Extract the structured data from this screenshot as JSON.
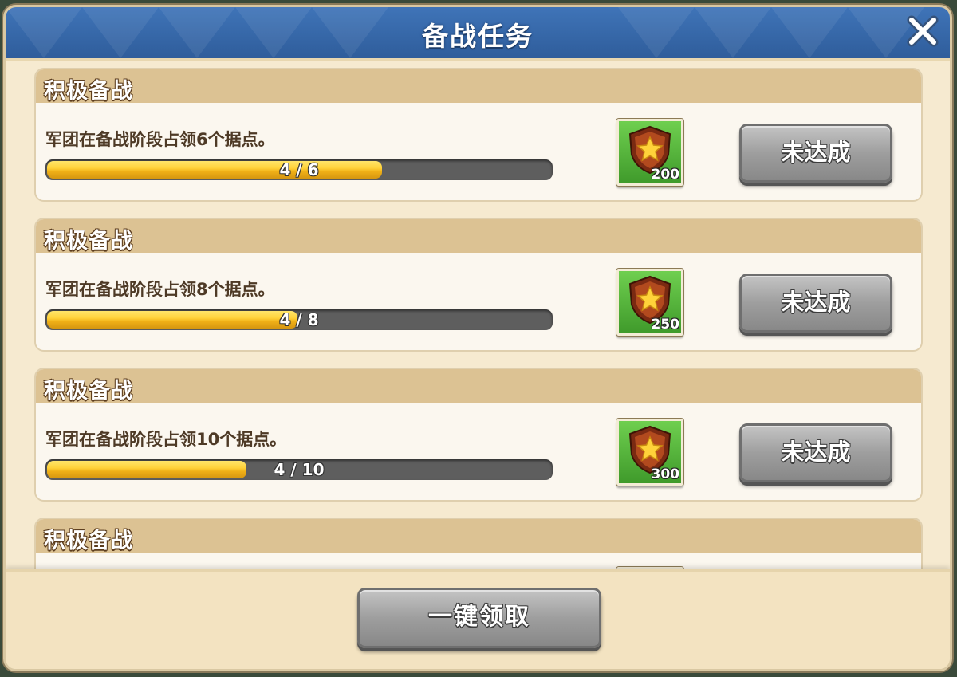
{
  "dialog": {
    "title": "备战任务",
    "close_icon": "close-icon"
  },
  "tasks": [
    {
      "title": "积极备战",
      "description": "军团在备战阶段占领6个据点。",
      "progress_current": 4,
      "progress_total": 6,
      "progress_text": "4 / 6",
      "reward_icon": "star-shield-icon",
      "reward_count": "200",
      "status_label": "未达成"
    },
    {
      "title": "积极备战",
      "description": "军团在备战阶段占领8个据点。",
      "progress_current": 4,
      "progress_total": 8,
      "progress_text": "4 / 8",
      "reward_icon": "star-shield-icon",
      "reward_count": "250",
      "status_label": "未达成"
    },
    {
      "title": "积极备战",
      "description": "军团在备战阶段占领10个据点。",
      "progress_current": 4,
      "progress_total": 10,
      "progress_text": "4 / 10",
      "reward_icon": "star-shield-icon",
      "reward_count": "300",
      "status_label": "未达成"
    },
    {
      "title": "积极备战"
    }
  ],
  "footer": {
    "claim_all_label": "一键领取"
  },
  "colors": {
    "title_bar": "#3f74b8",
    "progress_fill": "#ffd23a",
    "reward_bg": "#5bb83d"
  }
}
